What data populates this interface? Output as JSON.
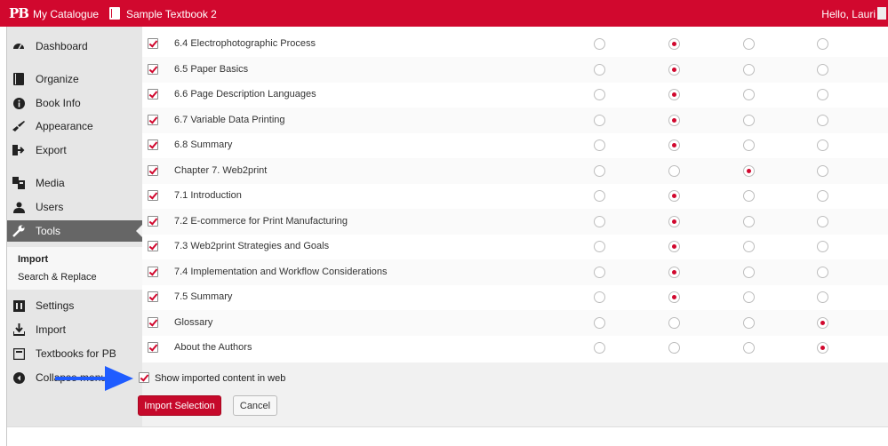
{
  "adminbar": {
    "logo": "PB",
    "catalogue": "My Catalogue",
    "book": "Sample Textbook 2",
    "greeting": "Hello, Lauri"
  },
  "sidebar": {
    "items": [
      {
        "label": "Dashboard",
        "icon": "dashboard-icon"
      },
      {
        "label": "Organize",
        "icon": "book-icon"
      },
      {
        "label": "Book Info",
        "icon": "info-icon"
      },
      {
        "label": "Appearance",
        "icon": "brush-icon"
      },
      {
        "label": "Export",
        "icon": "export-icon"
      },
      {
        "label": "Media",
        "icon": "media-icon"
      },
      {
        "label": "Users",
        "icon": "users-icon"
      },
      {
        "label": "Tools",
        "icon": "wrench-icon"
      },
      {
        "label": "Settings",
        "icon": "settings-icon"
      },
      {
        "label": "Import",
        "icon": "import-icon"
      },
      {
        "label": "Textbooks for PB",
        "icon": "textbooks-icon"
      },
      {
        "label": "Collapse menu",
        "icon": "collapse-icon"
      }
    ],
    "submenu": [
      "Import",
      "Search & Replace"
    ]
  },
  "rows": [
    {
      "title": "6.4 Electrophotographic Process",
      "selected": 1
    },
    {
      "title": "6.5 Paper Basics",
      "selected": 1
    },
    {
      "title": "6.6 Page Description Languages",
      "selected": 1
    },
    {
      "title": "6.7 Variable Data Printing",
      "selected": 1
    },
    {
      "title": "6.8 Summary",
      "selected": 1
    },
    {
      "title": "Chapter 7. Web2print",
      "selected": 2
    },
    {
      "title": "7.1 Introduction",
      "selected": 1
    },
    {
      "title": "7.2 E-commerce for Print Manufacturing",
      "selected": 1
    },
    {
      "title": "7.3 Web2print Strategies and Goals",
      "selected": 1
    },
    {
      "title": "7.4 Implementation and Workflow Considerations",
      "selected": 1
    },
    {
      "title": "7.5 Summary",
      "selected": 1
    },
    {
      "title": "Glossary",
      "selected": 3
    },
    {
      "title": "About the Authors",
      "selected": 3
    }
  ],
  "footer": {
    "show_label": "Show imported content in web",
    "import_button": "Import Selection",
    "cancel_button": "Cancel"
  },
  "colors": {
    "brand": "#d1082e",
    "arrow": "#1f5cff"
  }
}
